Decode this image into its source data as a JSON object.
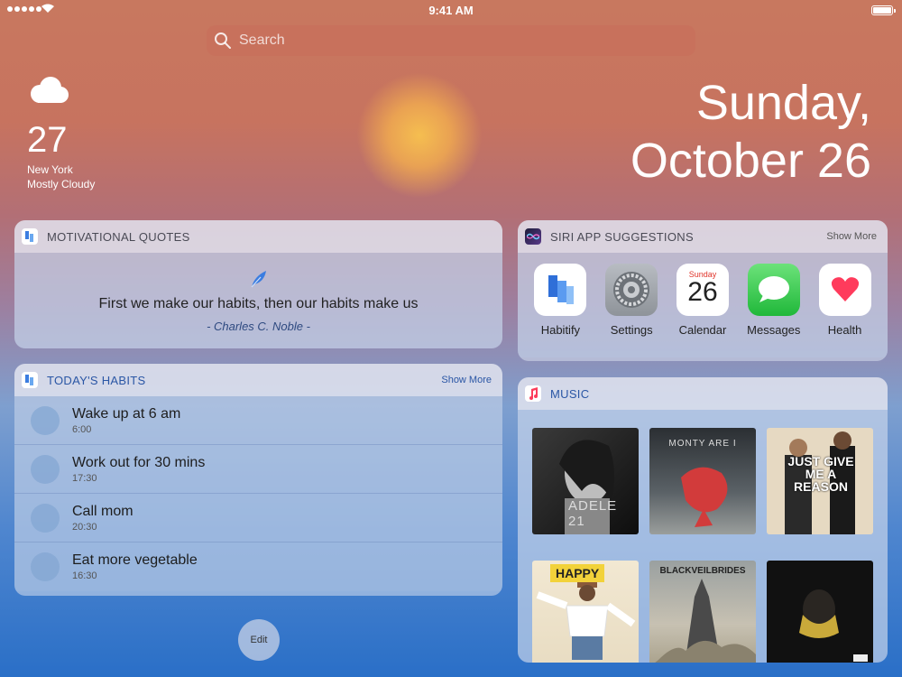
{
  "status_bar": {
    "time": "9:41 AM"
  },
  "search": {
    "placeholder": "Search"
  },
  "weather": {
    "temperature": "27",
    "city": "New York",
    "condition": "Mostly  Cloudy"
  },
  "date": {
    "line1": "Sunday,",
    "line2": "October 26"
  },
  "quotes_widget": {
    "title": "MOTIVATIONAL QUOTES",
    "quote": "First we make our habits, then our habits make us",
    "author": "- Charles C. Noble -"
  },
  "habits_widget": {
    "title": "TODAY'S HABITS",
    "show_more": "Show More",
    "habits": [
      {
        "name": "Wake up at 6 am",
        "time": "6:00"
      },
      {
        "name": "Work out for 30 mins",
        "time": "17:30"
      },
      {
        "name": "Call mom",
        "time": "20:30"
      },
      {
        "name": "Eat more vegetable",
        "time": "16:30"
      }
    ]
  },
  "siri_widget": {
    "title": "SIRI APP SUGGESTIONS",
    "show_more": "Show More",
    "apps": [
      {
        "label": "Habitify",
        "icon": "habitify-icon"
      },
      {
        "label": "Settings",
        "icon": "settings-icon"
      },
      {
        "label": "Calendar",
        "icon": "calendar-icon",
        "day_name": "Sunday",
        "day_number": "26"
      },
      {
        "label": "Messages",
        "icon": "messages-icon"
      },
      {
        "label": "Health",
        "icon": "health-icon"
      }
    ]
  },
  "music_widget": {
    "title": "MUSIC",
    "albums": [
      {
        "name": "adele-21-album",
        "cover_text": "ADELE 21"
      },
      {
        "name": "monty-are-i-album",
        "cover_text": "MONTY ARE I"
      },
      {
        "name": "just-give-me-a-reason-album",
        "cover_text": "JUST GIVE ME A REASON"
      },
      {
        "name": "happy-album",
        "cover_text": "HAPPY"
      },
      {
        "name": "black-veil-brides-album",
        "cover_text": "BLACKVEILBRIDES"
      },
      {
        "name": "dark-portrait-album",
        "cover_text": ""
      }
    ]
  },
  "edit_button": {
    "label": "Edit"
  }
}
